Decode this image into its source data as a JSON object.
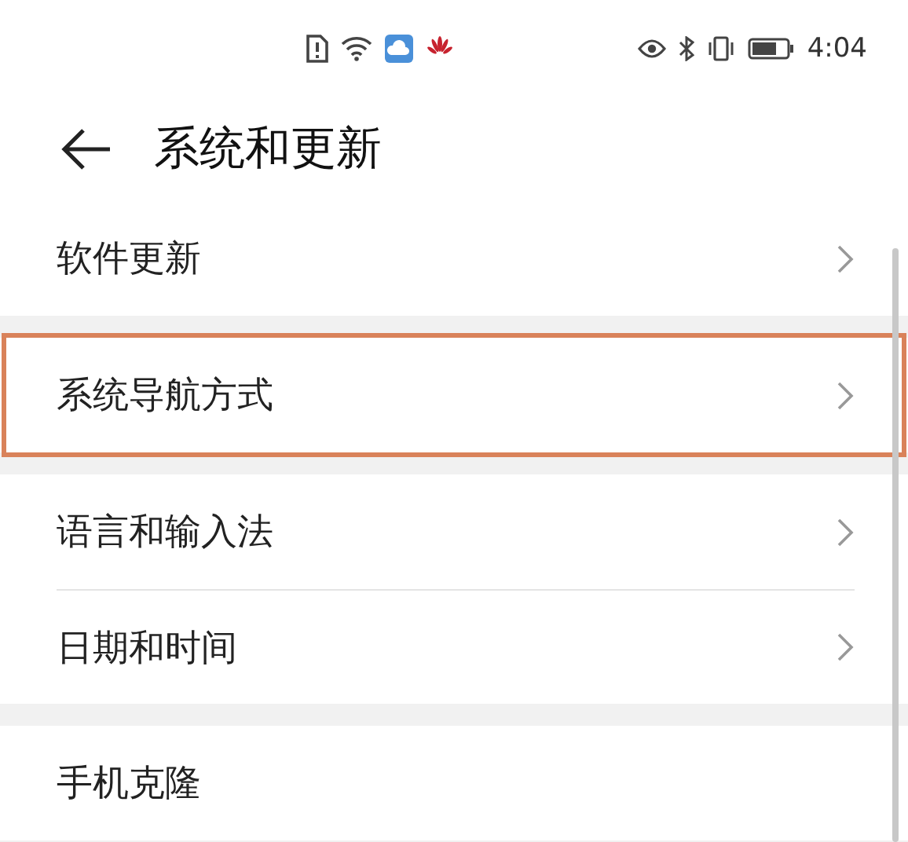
{
  "status_bar": {
    "time": "4:04"
  },
  "header": {
    "title": "系统和更新"
  },
  "groups": [
    [
      {
        "label": "软件更新",
        "highlighted": false,
        "chevron": true
      }
    ],
    [
      {
        "label": "系统导航方式",
        "highlighted": true,
        "chevron": true
      }
    ],
    [
      {
        "label": "语言和输入法",
        "highlighted": false,
        "chevron": true
      },
      {
        "label": "日期和时间",
        "highlighted": false,
        "chevron": true
      }
    ],
    [
      {
        "label": "手机克隆",
        "highlighted": false,
        "chevron": false
      }
    ]
  ]
}
